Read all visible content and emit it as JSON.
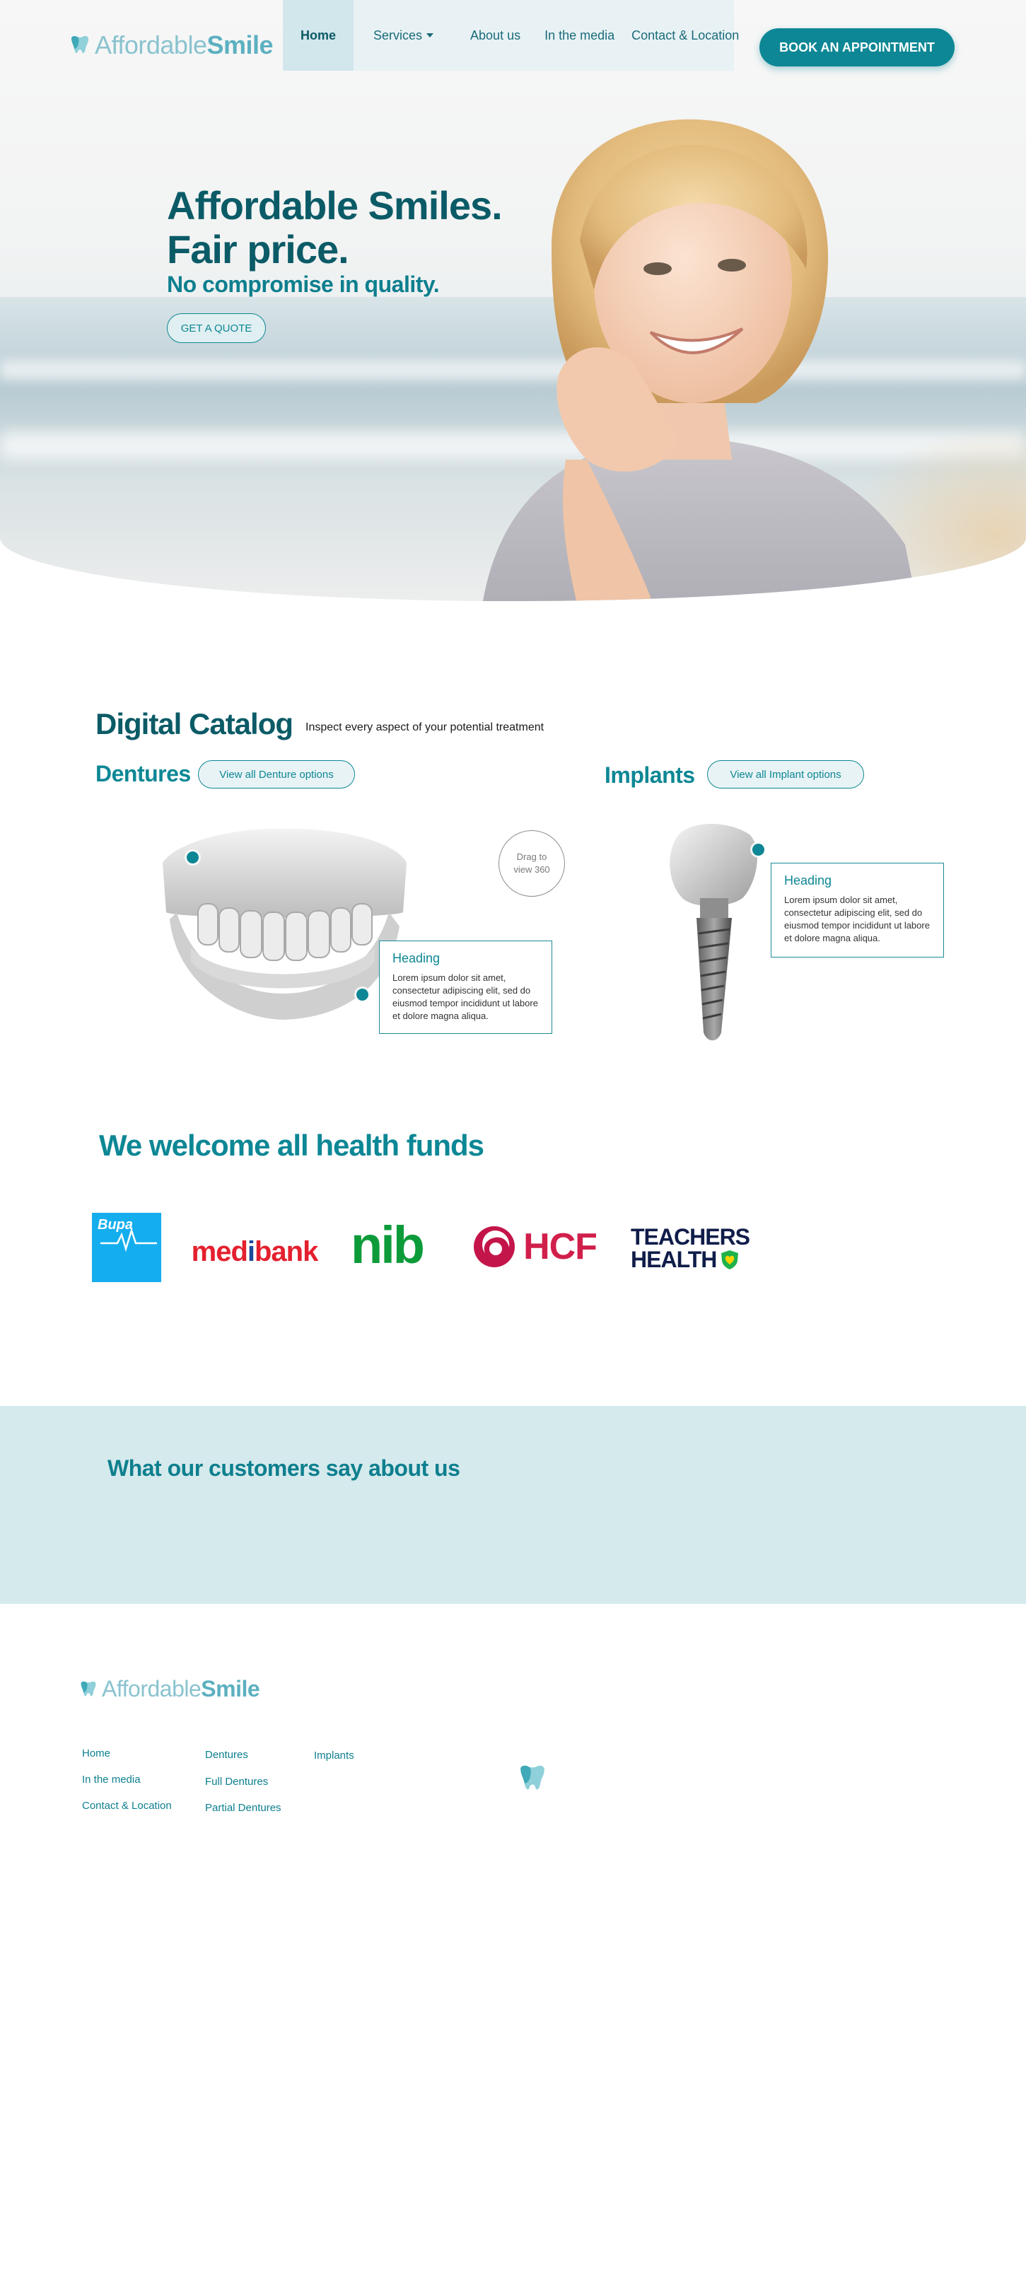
{
  "brand": {
    "logo_light": "Affordable",
    "logo_bold": "Smile"
  },
  "nav": {
    "items": [
      {
        "label": "Home"
      },
      {
        "label": "Services"
      },
      {
        "label": "About us"
      },
      {
        "label": "In the media"
      },
      {
        "label": "Contact & Location"
      }
    ],
    "cta": "BOOK AN APPOINTMENT"
  },
  "hero": {
    "title_line1": "Affordable Smiles.",
    "title_line2": "Fair price.",
    "subtitle": "No compromise in quality.",
    "cta": "GET A QUOTE"
  },
  "catalog": {
    "title": "Digital Catalog",
    "description": "Inspect every aspect of your potential treatment",
    "dentures": {
      "title": "Dentures",
      "button": "View all Denture options"
    },
    "implants": {
      "title": "Implants",
      "button": "View all  Implant options"
    },
    "drag_hint_line1": "Drag to",
    "drag_hint_line2": "view 360",
    "card_heading": "Heading",
    "card_text": "Lorem ipsum dolor sit amet, consectetur adipiscing elit, sed do eiusmod tempor incididunt ut labore et dolore magna aliqua."
  },
  "funds": {
    "title": "We welcome all health funds",
    "logos": {
      "bupa": "Bupa",
      "medibank_pre": "med",
      "medibank_i": "i",
      "medibank_post": "bank",
      "nib": "nib",
      "hcf": "HCF",
      "teachers_line1": "TEACHERS",
      "teachers_line2": "HEALTH"
    }
  },
  "testimonials": {
    "title": "What our customers say about us"
  },
  "footer": {
    "col1": [
      "Home",
      "In the media",
      "Contact & Location"
    ],
    "col2": [
      "Dentures",
      "Full Dentures",
      "Partial Dentures"
    ],
    "col3": [
      "Implants"
    ]
  },
  "colors": {
    "primary": "#0d8795",
    "dark_teal": "#0b5b67",
    "light_bg": "#d5eaed",
    "nav_bg": "#e8f2f4"
  }
}
